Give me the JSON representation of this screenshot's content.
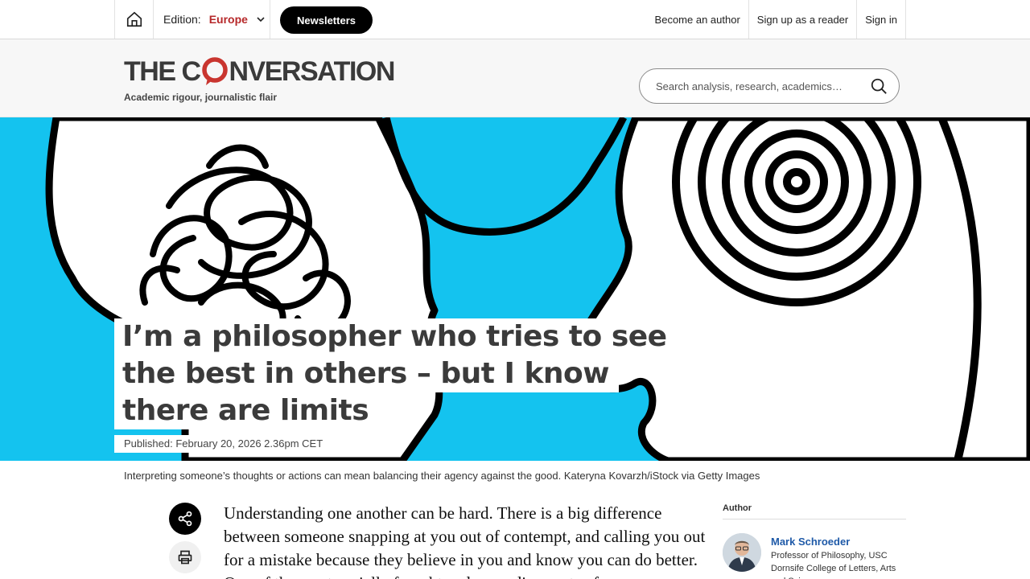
{
  "topbar": {
    "edition_label": "Edition:",
    "edition_value": "Europe",
    "newsletters_label": "Newsletters",
    "links": [
      "Become an author",
      "Sign up as a reader",
      "Sign in"
    ]
  },
  "masthead": {
    "logo_text_left": "THE C",
    "logo_text_right": "NVERSATION",
    "tagline": "Academic rigour, journalistic flair",
    "search_placeholder": "Search analysis, research, academics…"
  },
  "article": {
    "headline_lines": [
      "I’m a philosopher who tries to see",
      "the best in others – but I know",
      "there are limits"
    ],
    "published": "Published: February 20, 2026 2.36pm CET",
    "caption": "Interpreting someone’s thoughts or actions can mean balancing their agency against the good. Kateryna Kovarzh/iStock via Getty Images",
    "body_text": "Understanding one another can be hard. There is a big difference between someone snapping at you out of contempt, and calling you out for a mistake because they believe in you and know you can do better. One of the most socially fraught and rewarding parts of"
  },
  "author": {
    "heading": "Author",
    "name": "Mark Schroeder",
    "role": "Professor of Philosophy, USC Dornsife College of Letters, Arts and Sciences"
  },
  "colors": {
    "hero_bg": "#14c3ef",
    "brand_red": "#b6282a",
    "link_blue": "#1f5aa8"
  },
  "icons": [
    "home-icon",
    "chevron-down-icon",
    "search-icon",
    "share-icon",
    "print-icon"
  ]
}
